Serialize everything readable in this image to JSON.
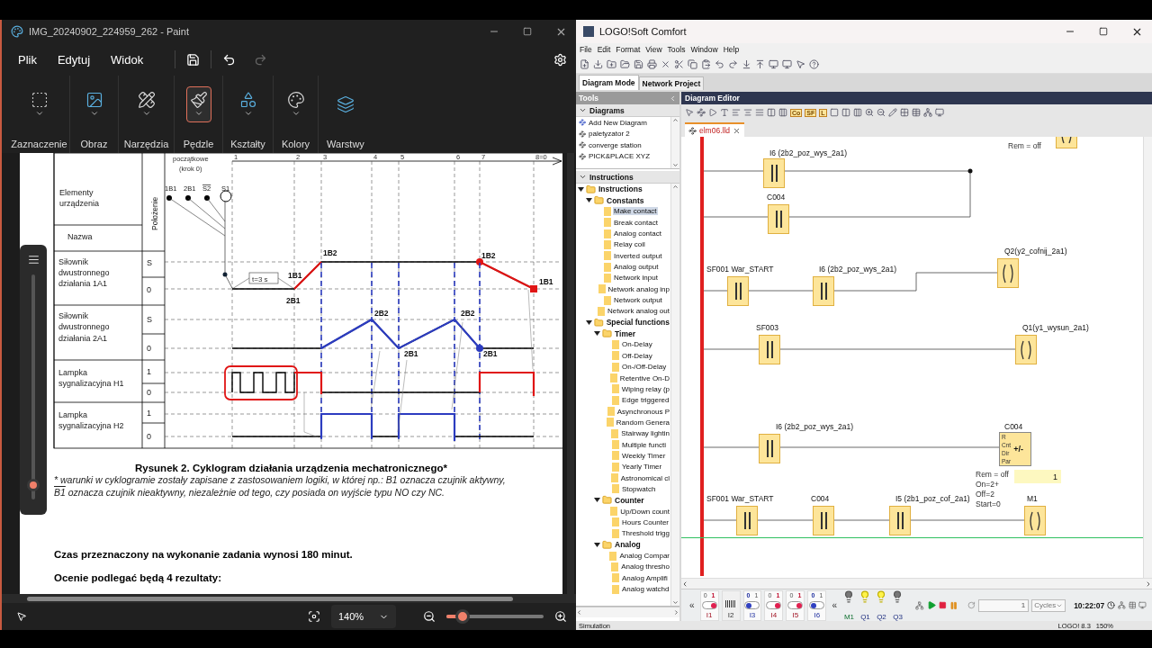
{
  "paint": {
    "window": {
      "title": "IMG_20240902_224959_262 - Paint"
    },
    "menu": [
      "Plik",
      "Edytuj",
      "Widok"
    ],
    "tools": [
      {
        "label": "Zaznaczenie",
        "kind": "selection",
        "selected": false,
        "dropdown": true
      },
      {
        "label": "Obraz",
        "kind": "image",
        "selected": false,
        "dropdown": true
      },
      {
        "label": "Narzędzia",
        "kind": "tools",
        "selected": false,
        "dropdown": true
      },
      {
        "label": "Pędzle",
        "kind": "brush",
        "selected": true,
        "dropdown": true
      },
      {
        "label": "Kształty",
        "kind": "shapes",
        "selected": false,
        "dropdown": true
      },
      {
        "label": "Kolory",
        "kind": "colors",
        "selected": false,
        "dropdown": true
      },
      {
        "label": "Warstwy",
        "kind": "layers",
        "selected": false,
        "dropdown": false
      }
    ],
    "size_slider": {
      "level": 0.04
    },
    "document": {
      "cyclogram": {
        "start_header": [
          "początkowe",
          "(krok 0)"
        ],
        "steps": [
          "1",
          "2",
          "3",
          "4",
          "5",
          "6",
          "7",
          "8=0"
        ],
        "header_rows": [
          [
            "Elementy",
            "urządzenia"
          ],
          [
            "Nazwa"
          ]
        ],
        "position_header": "Położenie",
        "sensors": [
          {
            "label": "1B1",
            "overlined": false
          },
          {
            "label": "2B1",
            "overlined": false
          },
          {
            "label": "S2",
            "overlined": true
          },
          {
            "label": "S1",
            "overlined": false
          }
        ],
        "rows": [
          {
            "name_lines": [
              "Siłownik",
              "dwustronnego",
              "działania 1A1"
            ],
            "positions": [
              "S",
              "0"
            ]
          },
          {
            "name_lines": [
              "Siłownik",
              "dwustronnego",
              "działania 2A1"
            ],
            "positions": [
              "S",
              "0"
            ]
          },
          {
            "name_lines": [
              "Lampka",
              "sygnalizacyjna H1"
            ],
            "positions": [
              "1",
              "0"
            ]
          },
          {
            "name_lines": [
              "Lampka",
              "sygnalizacyjna H2"
            ],
            "positions": [
              "1",
              "0"
            ]
          }
        ],
        "timer": "t=3 s",
        "signal_labels": [
          "1B1",
          "1B2",
          "2B1",
          "2B2",
          "2B1",
          "2B2",
          "2B1",
          "1B2",
          "1B1"
        ]
      },
      "caption": "Rysunek 2. Cyklogram działania urządzenia mechatronicznego*",
      "footnote_line_1": "* warunki w cyklogramie zostały zapisane z zastosowaniem logiki, w której np.: B1 oznacza czujnik aktywny,",
      "footnote_line_2": {
        "overlined": "B1",
        "text": " oznacza czujnik nieaktywny, niezależnie od tego, czy posiada on wyjście typu NO czy NC."
      },
      "paragraphs": [
        "Czas przeznaczony na wykonanie zadania wynosi 180 minut.",
        "Ocenie podlegać będą 4 rezultaty:"
      ]
    },
    "status_bar": {
      "zoom": "140%",
      "zoom_slider": {
        "level": 0.17
      }
    }
  },
  "logo": {
    "window": {
      "title": "LOGO!Soft Comfort"
    },
    "menu": [
      "File",
      "Edit",
      "Format",
      "View",
      "Tools",
      "Window",
      "Help"
    ],
    "mode_tabs": [
      {
        "label": "Diagram Mode",
        "selected": true
      },
      {
        "label": "Network Project",
        "selected": false
      }
    ],
    "tools_panel": {
      "title": "Tools",
      "diagrams": {
        "title": "Diagrams",
        "expanded": true,
        "items": [
          "Add New Diagram",
          "paletyzator 2",
          "converge station",
          "PICK&PLACE XYZ"
        ]
      },
      "instructions": {
        "title": "Instructions",
        "expanded": true,
        "tree": [
          {
            "label": "Instructions",
            "kind": "folder",
            "expanded": true,
            "children": [
              {
                "label": "Constants",
                "kind": "folder",
                "expanded": true,
                "children": [
                  {
                    "label": "Make contact",
                    "kind": "item",
                    "selected": true
                  },
                  {
                    "label": "Break contact",
                    "kind": "item",
                    "selected": false
                  },
                  {
                    "label": "Analog contact",
                    "kind": "item",
                    "selected": false
                  },
                  {
                    "label": "Relay coil",
                    "kind": "item",
                    "selected": false
                  },
                  {
                    "label": "Inverted output",
                    "kind": "item",
                    "selected": false
                  },
                  {
                    "label": "Analog output",
                    "kind": "item",
                    "selected": false
                  },
                  {
                    "label": "Network input",
                    "kind": "item",
                    "selected": false
                  },
                  {
                    "label": "Network analog inp",
                    "kind": "item",
                    "selected": false
                  },
                  {
                    "label": "Network output",
                    "kind": "item",
                    "selected": false
                  },
                  {
                    "label": "Network analog out",
                    "kind": "item",
                    "selected": false
                  }
                ]
              },
              {
                "label": "Special functions",
                "kind": "folder",
                "expanded": true,
                "children": [
                  {
                    "label": "Timer",
                    "kind": "folder",
                    "expanded": true,
                    "children": [
                      {
                        "label": "On-Delay",
                        "kind": "item",
                        "selected": false
                      },
                      {
                        "label": "Off-Delay",
                        "kind": "item",
                        "selected": false
                      },
                      {
                        "label": "On-/Off-Delay",
                        "kind": "item",
                        "selected": false
                      },
                      {
                        "label": "Retentive On-D",
                        "kind": "item",
                        "selected": false
                      },
                      {
                        "label": "Wiping relay (p",
                        "kind": "item",
                        "selected": false
                      },
                      {
                        "label": "Edge triggered",
                        "kind": "item",
                        "selected": false
                      },
                      {
                        "label": "Asynchronous P",
                        "kind": "item",
                        "selected": false
                      },
                      {
                        "label": "Random Genera",
                        "kind": "item",
                        "selected": false
                      },
                      {
                        "label": "Stairway lightin",
                        "kind": "item",
                        "selected": false
                      },
                      {
                        "label": "Multiple functi",
                        "kind": "item",
                        "selected": false
                      },
                      {
                        "label": "Weekly Timer",
                        "kind": "item",
                        "selected": false
                      },
                      {
                        "label": "Yearly Timer",
                        "kind": "item",
                        "selected": false
                      },
                      {
                        "label": "Astronomical cl",
                        "kind": "item",
                        "selected": false
                      },
                      {
                        "label": "Stopwatch",
                        "kind": "item",
                        "selected": false
                      }
                    ]
                  },
                  {
                    "label": "Counter",
                    "kind": "folder",
                    "expanded": true,
                    "children": [
                      {
                        "label": "Up/Down count",
                        "kind": "item",
                        "selected": false
                      },
                      {
                        "label": "Hours Counter",
                        "kind": "item",
                        "selected": false
                      },
                      {
                        "label": "Threshold trigg",
                        "kind": "item",
                        "selected": false
                      }
                    ]
                  },
                  {
                    "label": "Analog",
                    "kind": "folder",
                    "expanded": true,
                    "children": [
                      {
                        "label": "Analog Compar",
                        "kind": "item",
                        "selected": false
                      },
                      {
                        "label": "Analog thresho",
                        "kind": "item",
                        "selected": false
                      },
                      {
                        "label": "Analog Amplifi",
                        "kind": "item",
                        "selected": false
                      },
                      {
                        "label": "Analog watchd",
                        "kind": "item",
                        "selected": false
                      }
                    ]
                  }
                ]
              }
            ]
          }
        ]
      }
    },
    "editor": {
      "title": "Diagram Editor",
      "toolbar_labels": [
        "Co",
        "SF",
        "L"
      ],
      "tab": "elm06.lld",
      "top_note": "Rem = off",
      "elements": [
        {
          "kind": "contact",
          "label": "I6 (2b2_poz_wys_2a1)"
        },
        {
          "kind": "contact",
          "label": "C004"
        },
        {
          "kind": "contact",
          "label": "SF001 War_START"
        },
        {
          "kind": "contact",
          "label": "I6 (2b2_poz_wys_2a1)"
        },
        {
          "kind": "coil",
          "label": "Q2(y2_cofnij_2a1)"
        },
        {
          "kind": "contact",
          "label": "SF003"
        },
        {
          "kind": "coil",
          "label": "Q1(y1_wysun_2a1)"
        },
        {
          "kind": "contact",
          "label": "I6 (2b2_poz_wys_2a1)"
        },
        {
          "kind": "counter",
          "label": "C004",
          "symbol": "+/-",
          "pins": [
            "R",
            "Cnt",
            "Dir",
            "Par"
          ]
        },
        {
          "kind": "contact",
          "label": "SF001 War_START"
        },
        {
          "kind": "contact",
          "label": "C004"
        },
        {
          "kind": "contact",
          "label": "I5 (2b1_poz_cof_2a1)"
        },
        {
          "kind": "coil",
          "label": "M1"
        }
      ],
      "parameters": [
        "Rem = off",
        "On=2+",
        "Off=2",
        "Start=0"
      ],
      "counter_value": "1"
    },
    "simulation": {
      "inputs_toggle": "«",
      "inputs": [
        {
          "label": "I1",
          "kind": "switch",
          "on": true,
          "scale": [
            "0",
            "1"
          ]
        },
        {
          "label": "I2",
          "kind": "analog"
        },
        {
          "label": "I3",
          "kind": "switch",
          "on": false,
          "scale": [
            "0",
            "1"
          ]
        },
        {
          "label": "I4",
          "kind": "switch",
          "on": true,
          "scale": [
            "0",
            "1"
          ]
        },
        {
          "label": "I5",
          "kind": "switch",
          "on": true,
          "scale": [
            "0",
            "1"
          ]
        },
        {
          "label": "I6",
          "kind": "switch",
          "on": false,
          "scale": [
            "0",
            "1"
          ]
        }
      ],
      "outputs_toggle": "«",
      "outputs": [
        {
          "label": "M1",
          "on": false
        },
        {
          "label": "Q1",
          "on": true
        },
        {
          "label": "Q2",
          "on": true
        },
        {
          "label": "Q3",
          "on": false
        }
      ],
      "cycles": {
        "value": "1",
        "unit": "Cycles"
      },
      "time": "10:22:07"
    },
    "status_bar": {
      "mode": "Simulation",
      "device": "LOGO! 8.3",
      "zoom": "150%"
    }
  }
}
